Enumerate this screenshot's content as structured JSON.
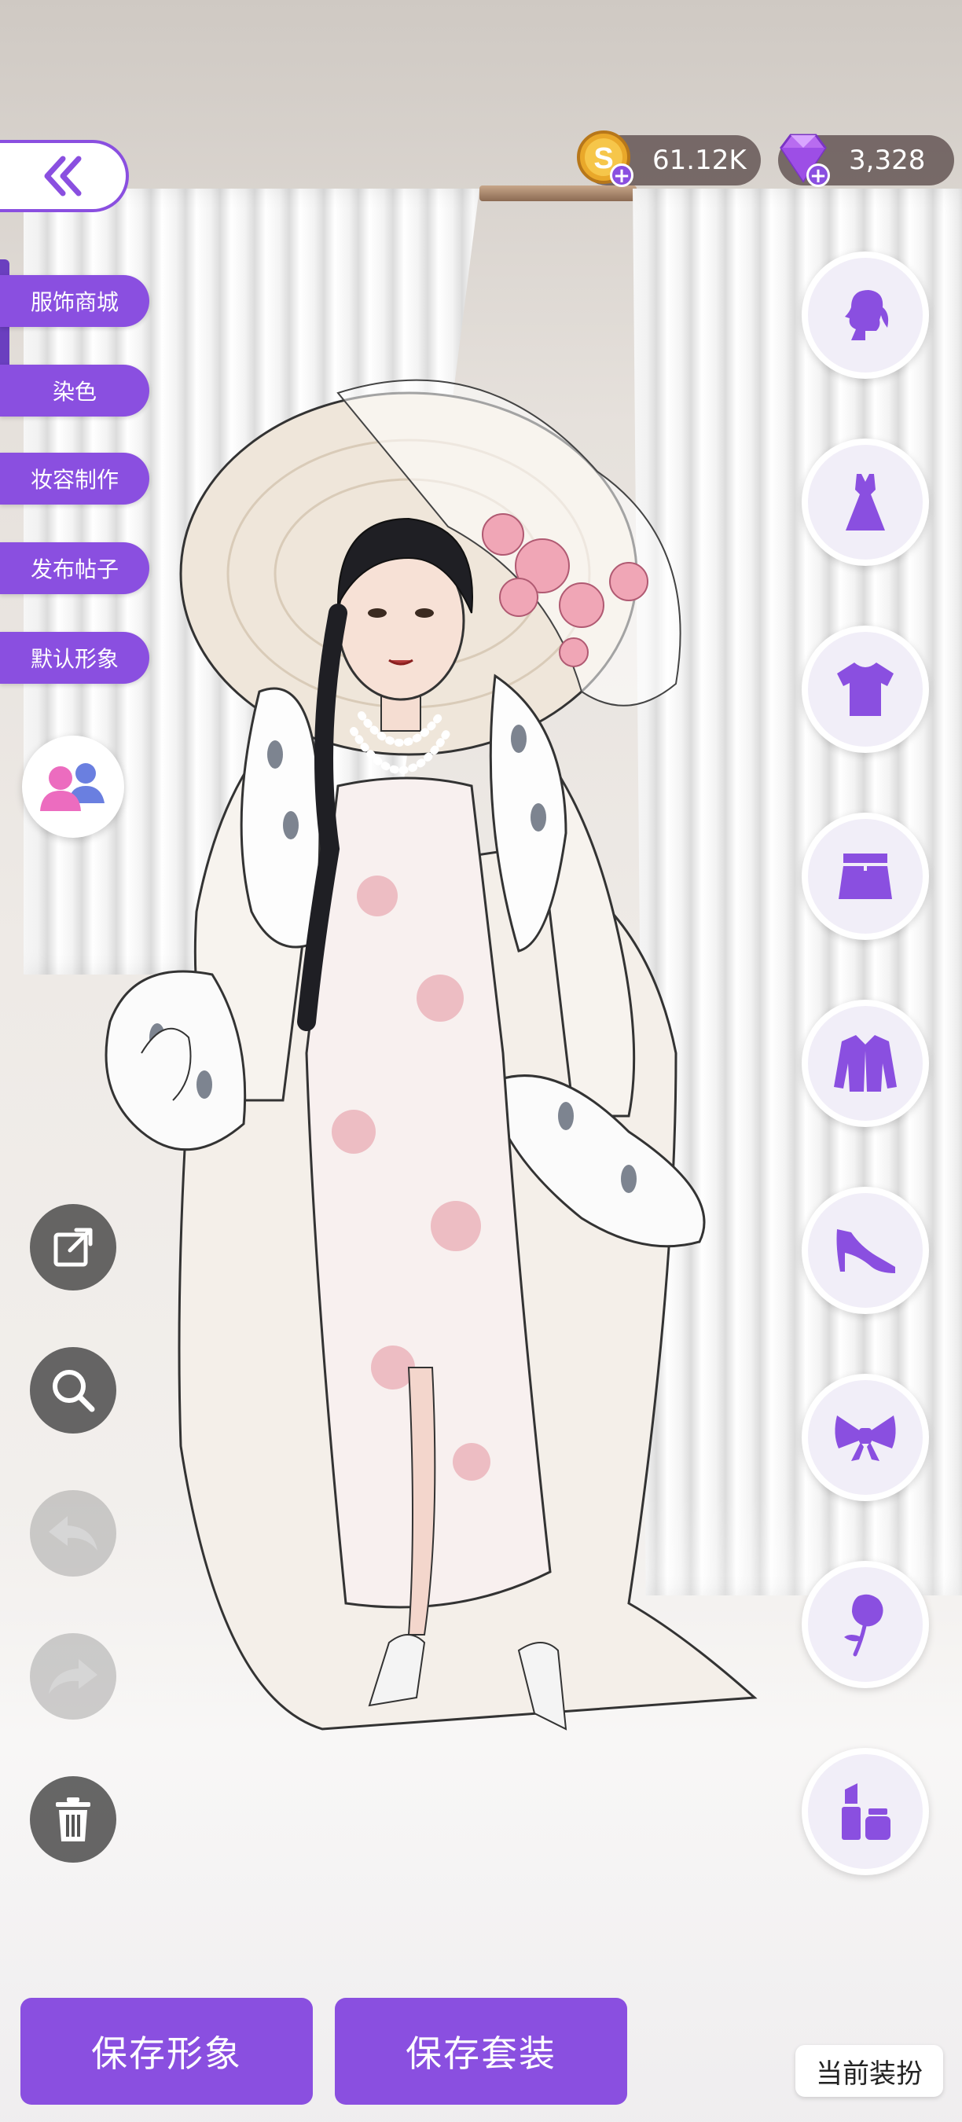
{
  "header": {
    "coins": {
      "value": "61.12K",
      "icon": "gold-coin-icon"
    },
    "gems": {
      "value": "3,328",
      "icon": "purple-diamond-icon"
    }
  },
  "left_menu": {
    "items": [
      {
        "label": "服饰商城"
      },
      {
        "label": "染色"
      },
      {
        "label": "妆容制作"
      },
      {
        "label": "发布帖子"
      },
      {
        "label": "默认形象"
      }
    ]
  },
  "categories": [
    {
      "name": "hair",
      "icon": "hair-silhouette-icon"
    },
    {
      "name": "dress",
      "icon": "dress-icon"
    },
    {
      "name": "top",
      "icon": "tshirt-icon"
    },
    {
      "name": "bottom",
      "icon": "skirt-icon"
    },
    {
      "name": "jacket",
      "icon": "jacket-icon"
    },
    {
      "name": "shoes",
      "icon": "high-heel-icon"
    },
    {
      "name": "accessory",
      "icon": "bow-icon"
    },
    {
      "name": "special",
      "icon": "rose-icon"
    },
    {
      "name": "makeup",
      "icon": "lipstick-icon"
    }
  ],
  "bottom": {
    "save_look": "保存形象",
    "save_outfit": "保存套装",
    "current_look": "当前装扮"
  },
  "colors": {
    "accent": "#8a4fe0",
    "accent_light": "#f1eef8"
  }
}
